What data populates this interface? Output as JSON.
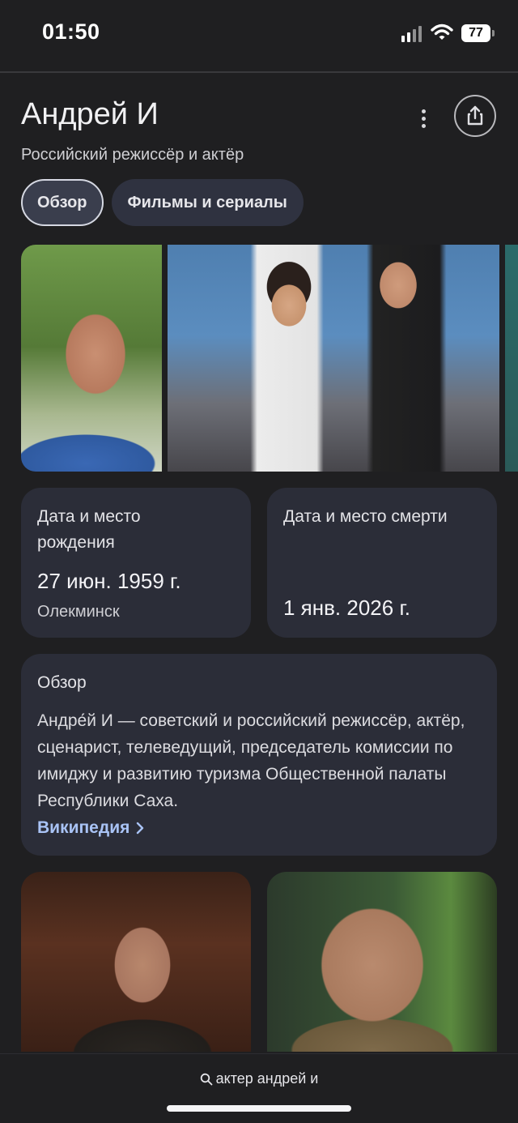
{
  "status_bar": {
    "time": "01:50",
    "battery": "77",
    "icons": [
      "cellular-signal-icon",
      "wifi-icon",
      "battery-icon"
    ]
  },
  "header": {
    "title": "Андрей И",
    "subtitle": "Российский режиссёр и актёр",
    "more_icon": "more-vertical-icon",
    "share_icon": "share-icon"
  },
  "tabs": [
    {
      "label": "Обзор",
      "active": true
    },
    {
      "label": "Фильмы и сериалы",
      "active": false
    }
  ],
  "facts": {
    "birth": {
      "label": "Дата и место рождения",
      "date": "27 июн. 1959 г.",
      "place": "Олекминск"
    },
    "death": {
      "label": "Дата и место смерти",
      "date": "1 янв. 2026 г."
    }
  },
  "overview": {
    "heading": "Обзор",
    "text": "Андре́й И — советский и российский режиссёр, актёр, сценарист, телеведущий, председатель комиссии по имиджу и развитию туризма Общественной палаты Республики Саха.",
    "link_label": "Википедия",
    "link_icon": "chevron-right-icon"
  },
  "bottom_bar": {
    "search_icon": "search-icon",
    "query": "актер андрей и"
  },
  "colors": {
    "background": "#1f1f21",
    "card": "#2b2d38",
    "link": "#a9c3f5"
  }
}
